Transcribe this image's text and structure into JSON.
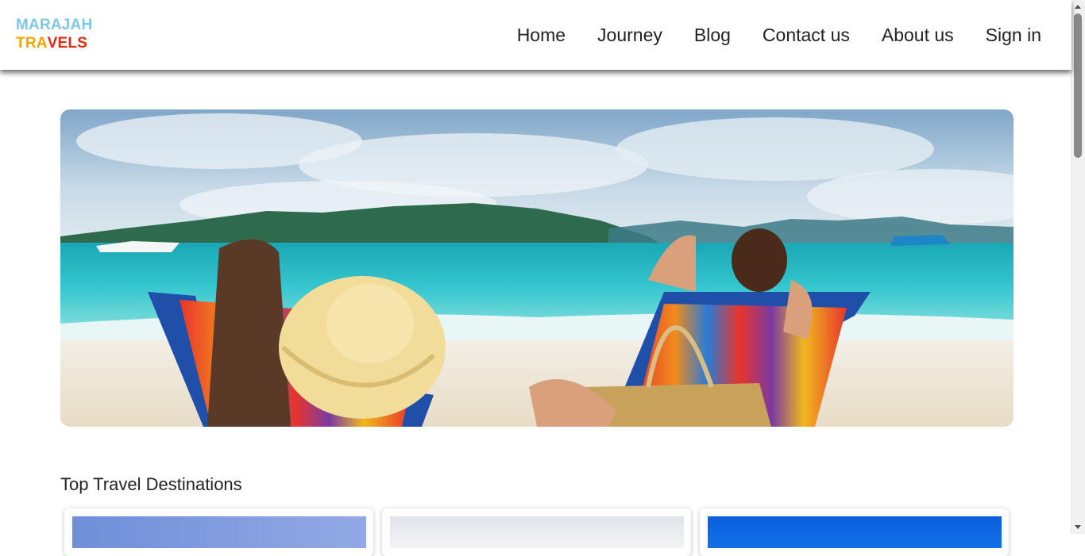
{
  "logo": {
    "line1": "MARAJAH",
    "line2_letters": [
      {
        "ch": "T",
        "color": "#f5a300"
      },
      {
        "ch": "R",
        "color": "#f5a300"
      },
      {
        "ch": "A",
        "color": "#f5a300"
      },
      {
        "ch": "V",
        "color": "#e02a10"
      },
      {
        "ch": "E",
        "color": "#e02a10"
      },
      {
        "ch": "L",
        "color": "#e02a10"
      },
      {
        "ch": "S",
        "color": "#e02a10"
      }
    ]
  },
  "nav": {
    "items": [
      {
        "label": "Home"
      },
      {
        "label": "Journey"
      },
      {
        "label": "Blog"
      },
      {
        "label": "Contact us"
      },
      {
        "label": "About us"
      },
      {
        "label": "Sign in"
      }
    ]
  },
  "hero": {
    "image_alt": "Couple relaxing on beach chairs by turquoise sea"
  },
  "destinations": {
    "title": "Top Travel Destinations",
    "cards": [
      {
        "color": "#7f9ee0"
      },
      {
        "color": "#e4e8ee"
      },
      {
        "color": "#0a63e0"
      }
    ]
  }
}
